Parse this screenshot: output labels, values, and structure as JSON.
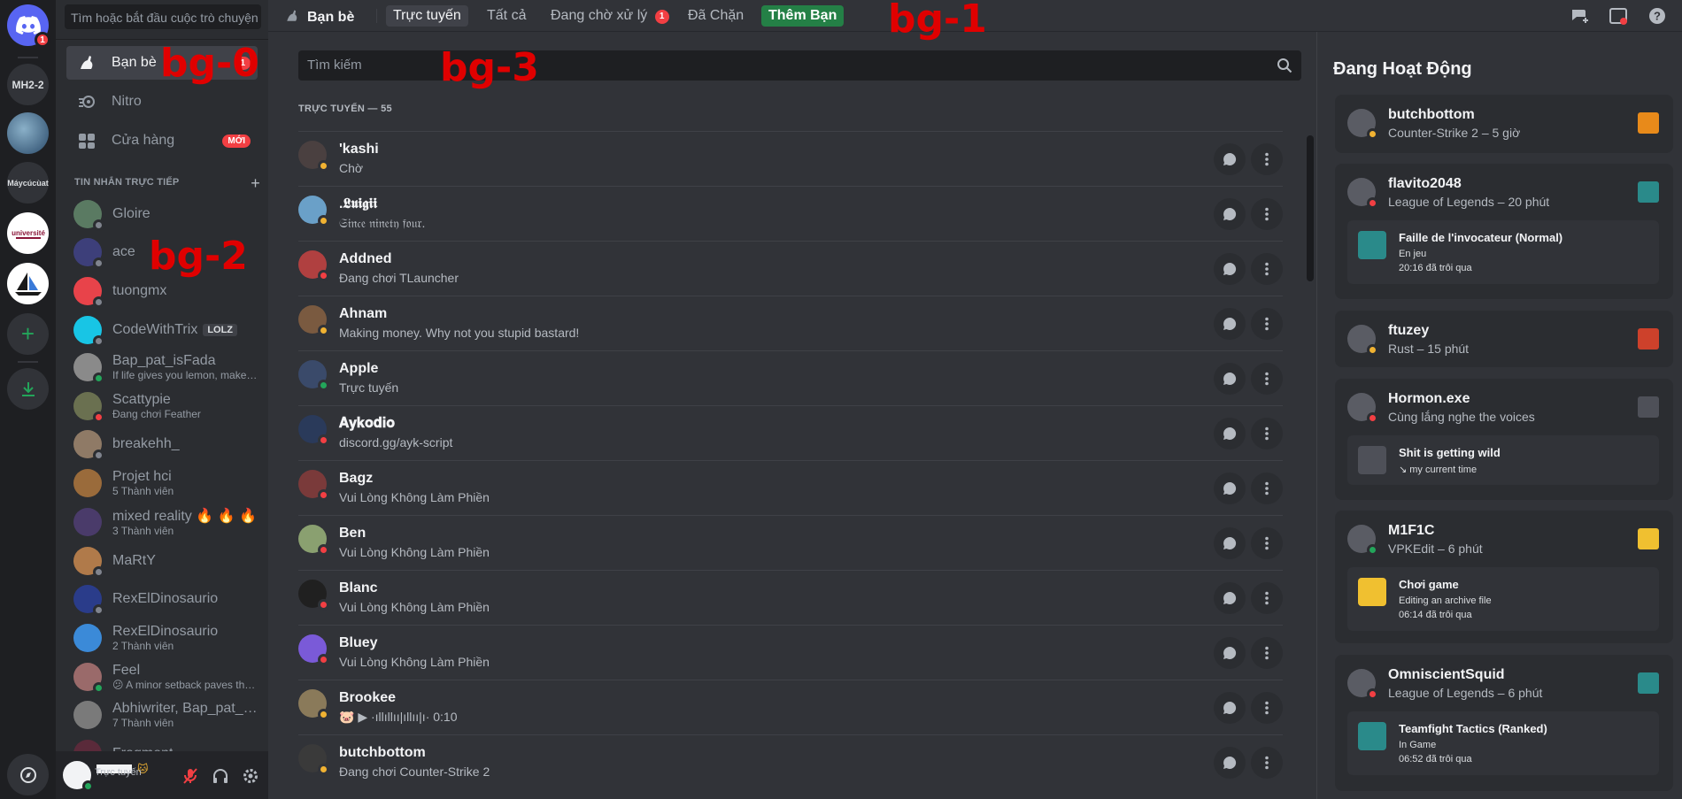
{
  "colors": {
    "online": "#23a55a",
    "idle": "#f0b232",
    "dnd": "#f23f43",
    "offline": "#80848e",
    "blurple": "#5865f2",
    "add_friend": "#248046"
  },
  "rail": {
    "home_badge": "1",
    "servers": [
      {
        "label": "MH2-2"
      },
      {
        "label": "Máycúcùat"
      }
    ]
  },
  "sidebar": {
    "search_placeholder": "Tìm hoặc bắt đầu cuộc trò chuyện",
    "nav": [
      {
        "label": "Bạn bè",
        "badge": "1"
      },
      {
        "label": "Nitro"
      },
      {
        "label": "Cửa hàng",
        "badge": "MỚI"
      }
    ],
    "dm_header": "TIN NHẮN TRỰC TIẾP",
    "dms": [
      {
        "name": "Gloire",
        "sub": "",
        "color": "#5a7a62",
        "status": "offline"
      },
      {
        "name": "ace",
        "sub": "",
        "color": "#3d3f7a",
        "status": "offline"
      },
      {
        "name": "tuongmx",
        "sub": "",
        "color": "#e8434a",
        "status": "offline"
      },
      {
        "name": "CodeWithTrix",
        "tag": "LOLZ",
        "sub": "",
        "color": "#18c5e5",
        "status": "offline"
      },
      {
        "name": "Bap_pat_isFada",
        "sub": "If life gives you lemon, make l...",
        "color": "#8a8a8a",
        "status": "online"
      },
      {
        "name": "Scattypie",
        "sub": "Đang chơi Feather",
        "color": "#6a7050",
        "status": "dnd"
      },
      {
        "name": "breakehh_",
        "sub": "",
        "color": "#8f7a66",
        "status": "offline"
      },
      {
        "name": "Projet hci",
        "sub": "5 Thành viên",
        "color": "#9a6b3b",
        "status": ""
      },
      {
        "name": "mixed reality 🔥 🔥 🔥",
        "sub": "3 Thành viên",
        "color": "#4a3b6a",
        "status": ""
      },
      {
        "name": "MaRtY",
        "sub": "",
        "color": "#b07a4a",
        "status": "offline"
      },
      {
        "name": "RexElDinosaurio",
        "sub": "",
        "color": "#2a3c8a",
        "status": "offline"
      },
      {
        "name": "RexElDinosaurio",
        "sub": "2 Thành viên",
        "color": "#3b8ad8",
        "status": ""
      },
      {
        "name": "Feel",
        "sub": "😕 A minor setback paves the...",
        "color": "#9a6a6a",
        "status": "online"
      },
      {
        "name": "Abhiwriter, Bap_pat_i...",
        "sub": "7 Thành viên",
        "color": "#7a7a7a",
        "status": ""
      },
      {
        "name": "Fragment",
        "sub": "",
        "color": "#5a2a3a",
        "status": "offline"
      }
    ],
    "user": {
      "status": "Trực tuyến"
    }
  },
  "topbar": {
    "title": "Bạn bè",
    "tabs": [
      {
        "label": "Trực tuyến",
        "active": true
      },
      {
        "label": "Tất cả"
      },
      {
        "label": "Đang chờ xử lý",
        "badge": "1"
      },
      {
        "label": "Đã Chặn"
      },
      {
        "label": "Thêm Bạn"
      }
    ]
  },
  "main": {
    "search_placeholder": "Tìm kiếm",
    "count_label": "TRỰC TUYẾN — 55",
    "friends": [
      {
        "name": "'kashi",
        "sub": "Chờ",
        "status": "idle",
        "color": "#4a4040"
      },
      {
        "name": ".𝕷𝖚𝖎𝖌𝖎𝖎",
        "sub": "𝔖𝔦𝔫𝔠𝔢 𝔫𝔦𝔫𝔢𝔱𝔶 𝔣𝔬𝔲𝔯.",
        "status": "idle",
        "color": "#6aa0c8"
      },
      {
        "name": "Addned",
        "sub": "Đang chơi TLauncher",
        "status": "dnd",
        "color": "#b04040"
      },
      {
        "name": "Ahnam",
        "sub": "Making money. Why not you stupid bastard!",
        "status": "idle",
        "color": "#7a5a40"
      },
      {
        "name": "Apple",
        "sub": "Trực tuyến",
        "status": "online",
        "color": "#3a4a6a"
      },
      {
        "name": "𝐀𝐲𝐤𝐨𝐝𝐢𝐨",
        "sub": "discord.gg/ayk-script",
        "status": "dnd",
        "color": "#2a3a5a"
      },
      {
        "name": "Bagz",
        "sub": "Vui Lòng Không Làm Phiền",
        "status": "dnd",
        "color": "#7a3a3a"
      },
      {
        "name": "Ben",
        "sub": "Vui Lòng Không Làm Phiền",
        "status": "dnd",
        "color": "#8aa070"
      },
      {
        "name": "Blanc",
        "sub": "Vui Lòng Không Làm Phiền",
        "status": "dnd",
        "color": "#202020"
      },
      {
        "name": "Bluey",
        "sub": "Vui Lòng Không Làm Phiền",
        "status": "dnd",
        "color": "#7a5ad8"
      },
      {
        "name": "Brookee",
        "sub": "🐷 ▶ ·ıllıllıı|ıllıı|ı· 0:10",
        "status": "idle",
        "color": "#8a7a5a"
      },
      {
        "name": "butchbottom",
        "sub": "Đang chơi Counter-Strike 2",
        "status": "idle",
        "color": "#3a3a3a"
      }
    ]
  },
  "activity": {
    "title": "Đang Hoạt Động",
    "cards": [
      {
        "name": "butchbottom",
        "game": "Counter-Strike 2 – 5 giờ",
        "status": "idle",
        "icon_color": "#e88a1a"
      },
      {
        "name": "flavito2048",
        "game": "League of Legends – 20 phút",
        "status": "dnd",
        "icon_color": "#2a8a8a",
        "detail": {
          "title": "Faille de l'invocateur (Normal)",
          "l1": "En jeu",
          "l2": "20:16 đã trôi qua"
        }
      },
      {
        "name": "ftuzey",
        "game": "Rust – 15 phút",
        "status": "idle",
        "icon_color": "#cd412b"
      },
      {
        "name": "Hormon.exe",
        "game": "Cùng lắng nghe the voices",
        "status": "dnd",
        "icon_color": "#4e5058",
        "detail": {
          "title": "Shit is getting wild",
          "l1": "↘ my current time"
        }
      },
      {
        "name": "M1F1C",
        "game": "VPKEdit – 6 phút",
        "status": "online",
        "icon_color": "#f0c030",
        "detail": {
          "title": "Chơi game",
          "l1": "Editing an archive file",
          "l2": "06:14 đã trôi qua"
        }
      },
      {
        "name": "OmniscientSquid",
        "game": "League of Legends – 6 phút",
        "status": "dnd",
        "icon_color": "#2a8a8a",
        "detail": {
          "title": "Teamfight Tactics (Ranked)",
          "l1": "In Game",
          "l2": "06:52 đã trôi qua"
        }
      }
    ]
  },
  "overlays": [
    "bg-0",
    "bg-1",
    "bg-2",
    "bg-3"
  ]
}
